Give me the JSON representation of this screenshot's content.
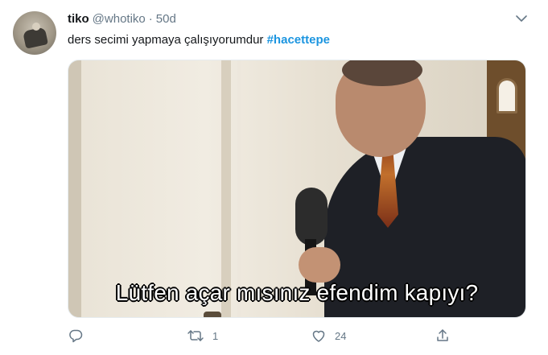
{
  "tweet": {
    "author_name": "tiko",
    "author_handle": "@whotiko",
    "separator": "·",
    "time": "50d",
    "text_plain": "ders secimi yapmaya çalışıyorumdur ",
    "hashtag": "#hacettepe"
  },
  "media": {
    "subtitle": "Lütfen açar mısınız efendim kapıyı?"
  },
  "actions": {
    "reply_count": "",
    "retweet_count": "1",
    "like_count": "24"
  },
  "colors": {
    "link": "#1b95e0",
    "muted": "#657786",
    "text": "#14171a"
  },
  "icons": [
    "avatar",
    "caret-down-icon",
    "reply-icon",
    "retweet-icon",
    "like-icon",
    "share-icon"
  ]
}
